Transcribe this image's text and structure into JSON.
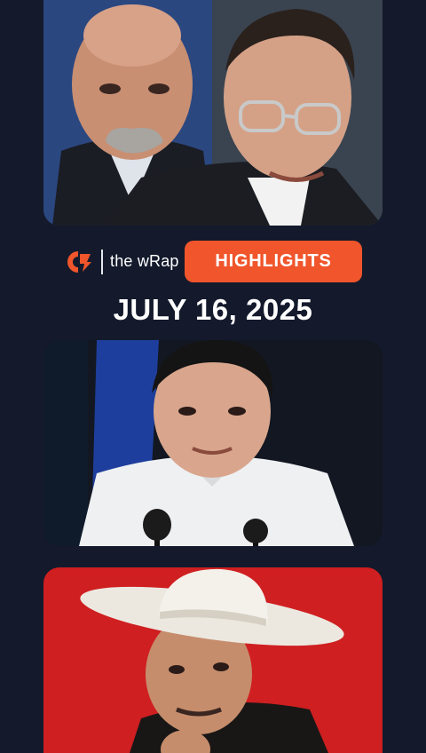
{
  "brand": {
    "logo_icon": "rappler-logo-icon",
    "name": "the wRap"
  },
  "badge": {
    "label": "HIGHLIGHTS",
    "color": "#f0552b"
  },
  "date": "JULY 16, 2025",
  "colors": {
    "background": "#141a2c"
  },
  "images": [
    {
      "name": "top-news-photo"
    },
    {
      "name": "middle-news-photo"
    },
    {
      "name": "bottom-news-photo"
    }
  ]
}
